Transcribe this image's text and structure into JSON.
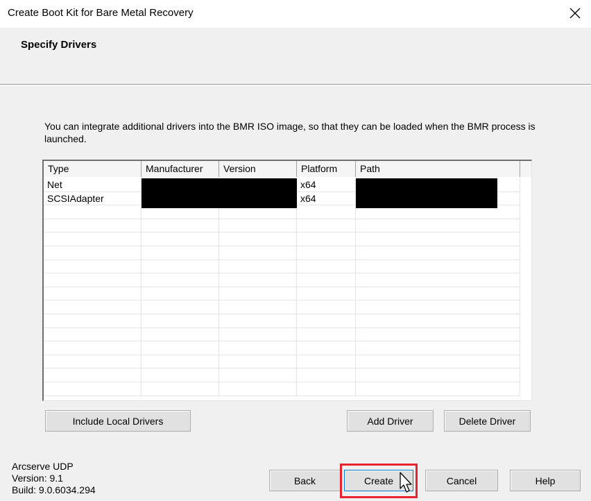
{
  "window": {
    "title": "Create Boot Kit for Bare Metal Recovery",
    "close_icon": "close-icon"
  },
  "header": {
    "title": "Specify Drivers"
  },
  "intro_text": "You can integrate additional drivers into the BMR ISO image, so that they can be loaded when the BMR process is launched.",
  "drivers_table": {
    "columns": [
      "Type",
      "Manufacturer",
      "Version",
      "Platform",
      "Path"
    ],
    "rows": [
      {
        "type": "Net",
        "manufacturer": "",
        "version": "",
        "platform": "x64",
        "path": ""
      },
      {
        "type": "SCSIAdapter",
        "manufacturer": "",
        "version": "",
        "platform": "x64",
        "path": ""
      }
    ]
  },
  "buttons": {
    "include_local_drivers": "Include Local Drivers",
    "add_driver": "Add Driver",
    "delete_driver": "Delete Driver",
    "back": "Back",
    "create": "Create",
    "cancel": "Cancel",
    "help": "Help"
  },
  "footer": {
    "product": "Arcserve UDP",
    "version": "Version: 9.1",
    "build": "Build: 9.0.6034.294"
  },
  "colors": {
    "highlight": "#e8232f",
    "focus_border": "#0078d7"
  }
}
